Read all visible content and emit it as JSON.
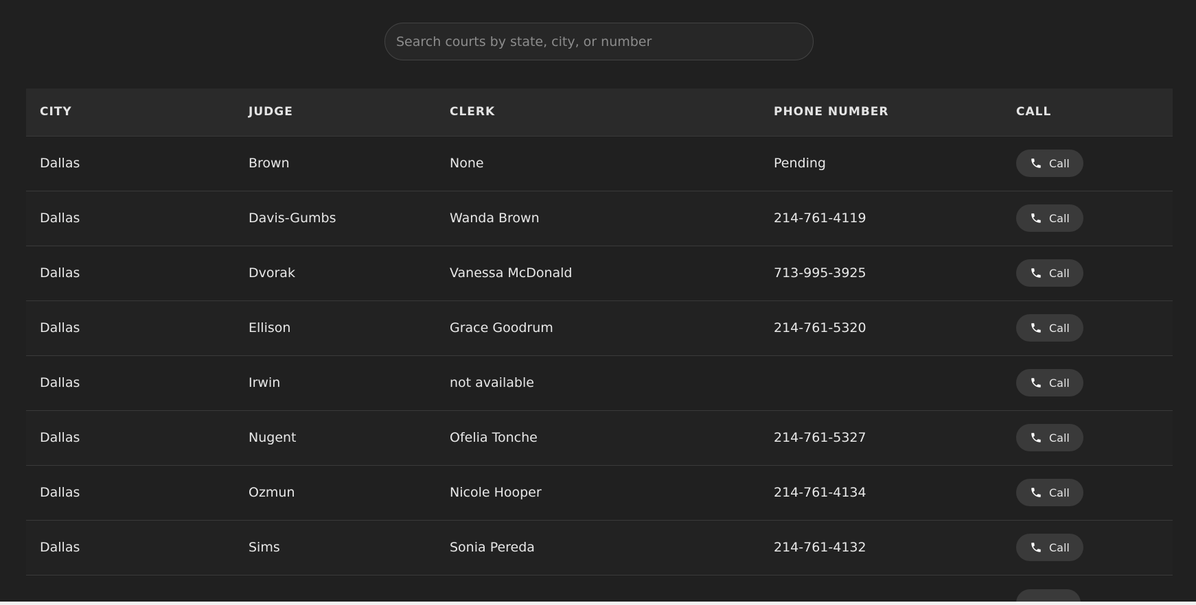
{
  "search": {
    "placeholder": "Search courts by state, city, or number",
    "value": ""
  },
  "table": {
    "headers": [
      "CITY",
      "JUDGE",
      "CLERK",
      "PHONE NUMBER",
      "CALL"
    ],
    "rows": [
      {
        "city": "Dallas",
        "judge": "Brown",
        "clerk": "None",
        "phone": "Pending",
        "call_label": "Call"
      },
      {
        "city": "Dallas",
        "judge": "Davis-Gumbs",
        "clerk": "Wanda Brown",
        "phone": "214-761-4119",
        "call_label": "Call"
      },
      {
        "city": "Dallas",
        "judge": "Dvorak",
        "clerk": "Vanessa McDonald",
        "phone": "713-995-3925",
        "call_label": "Call"
      },
      {
        "city": "Dallas",
        "judge": "Ellison",
        "clerk": "Grace Goodrum",
        "phone": "214-761-5320",
        "call_label": "Call"
      },
      {
        "city": "Dallas",
        "judge": "Irwin",
        "clerk": "not available",
        "phone": "",
        "call_label": "Call"
      },
      {
        "city": "Dallas",
        "judge": "Nugent",
        "clerk": "Ofelia Tonche",
        "phone": "214-761-5327",
        "call_label": "Call"
      },
      {
        "city": "Dallas",
        "judge": "Ozmun",
        "clerk": "Nicole Hooper",
        "phone": "214-761-4134",
        "call_label": "Call"
      },
      {
        "city": "Dallas",
        "judge": "Sims",
        "clerk": "Sonia Pereda",
        "phone": "214-761-4132",
        "call_label": "Call"
      }
    ]
  },
  "icons": {
    "call": "phone-icon"
  },
  "colors": {
    "background": "#202020",
    "header_background": "#2a2a2a",
    "button_background": "#3a3a3a",
    "text": "#e8e8e8"
  }
}
